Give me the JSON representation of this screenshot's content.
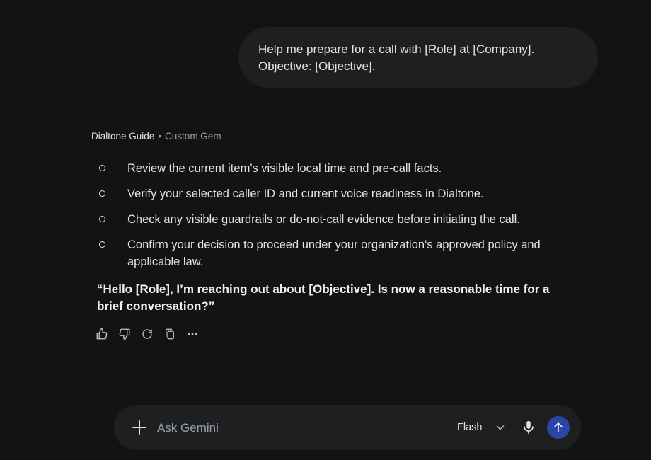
{
  "user_message": {
    "line1": "Help me prepare for a call with [Role] at [Company].",
    "line2": "Objective: [Objective]."
  },
  "response": {
    "gem_name": "Dialtone Guide",
    "separator": "•",
    "gem_type": "Custom Gem",
    "bullets": [
      "Review the current item's visible local time and pre-call facts.",
      "Verify your selected caller ID and current voice readiness in Dialtone.",
      "Check any visible guardrails or do-not-call evidence before initiating the call.",
      "Confirm your decision to proceed under your organization's approved policy and applicable law."
    ],
    "quote": "“Hello [Role], I’m reaching out about [Objective]. Is now a reasonable time for a brief conversation?”",
    "actions": [
      "thumbs-up-icon",
      "thumbs-down-icon",
      "regenerate-icon",
      "copy-icon",
      "more-icon"
    ]
  },
  "composer": {
    "placeholder": "Ask Gemini",
    "model": "Flash",
    "icons": [
      "plus-icon",
      "chevron-down-icon",
      "mic-icon",
      "send-arrow-icon"
    ],
    "send_color": "#2945a8"
  },
  "colors": {
    "background": "#131314",
    "bubble": "#1e1f20",
    "text": "#e3e3e3",
    "muted": "#9aa0a6"
  }
}
